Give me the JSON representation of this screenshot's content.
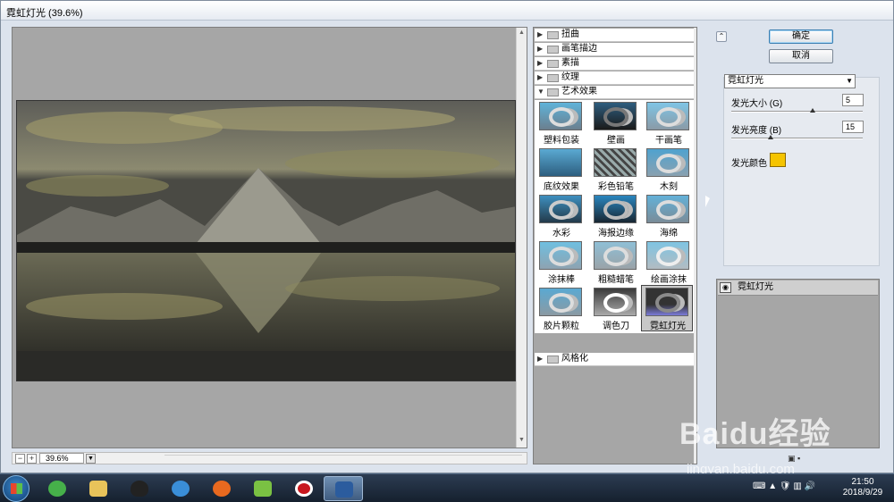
{
  "window": {
    "title": "霓虹灯光 (39.6%)"
  },
  "preview": {
    "zoom": "39.6%"
  },
  "categories": [
    {
      "label": "扭曲",
      "expanded": false
    },
    {
      "label": "画笔描边",
      "expanded": false
    },
    {
      "label": "素描",
      "expanded": false
    },
    {
      "label": "纹理",
      "expanded": false
    },
    {
      "label": "艺术效果",
      "expanded": true
    },
    {
      "label": "风格化",
      "expanded": false
    }
  ],
  "thumbnails": [
    {
      "label": "塑料包装"
    },
    {
      "label": "壁画"
    },
    {
      "label": "干画笔"
    },
    {
      "label": "底纹效果"
    },
    {
      "label": "彩色铅笔"
    },
    {
      "label": "木刻"
    },
    {
      "label": "水彩"
    },
    {
      "label": "海报边缘"
    },
    {
      "label": "海绵"
    },
    {
      "label": "涂抹棒"
    },
    {
      "label": "粗糙蜡笔"
    },
    {
      "label": "绘画涂抹"
    },
    {
      "label": "胶片颗粒"
    },
    {
      "label": "调色刀"
    },
    {
      "label": "霓虹灯光",
      "selected": true
    }
  ],
  "buttons": {
    "ok": "确定",
    "cancel": "取消"
  },
  "settings": {
    "filter": "霓虹灯光",
    "glow_size": {
      "label": "发光大小 (G)",
      "value": "5",
      "fraction": 0.62
    },
    "glow_brightness": {
      "label": "发光亮度 (B)",
      "value": "15",
      "fraction": 0.3
    },
    "glow_color": {
      "label": "发光颜色",
      "color": "#f5c400"
    }
  },
  "layers": {
    "label": "霓虹灯光"
  },
  "taskbar": {
    "clock_time": "21:50",
    "clock_date": "2018/9/29"
  },
  "watermark": {
    "text": "Baidu经验",
    "url": "jingyan.baidu.com"
  },
  "colors": {
    "accent": "#3c7fb1",
    "glow": "#f5c400"
  }
}
